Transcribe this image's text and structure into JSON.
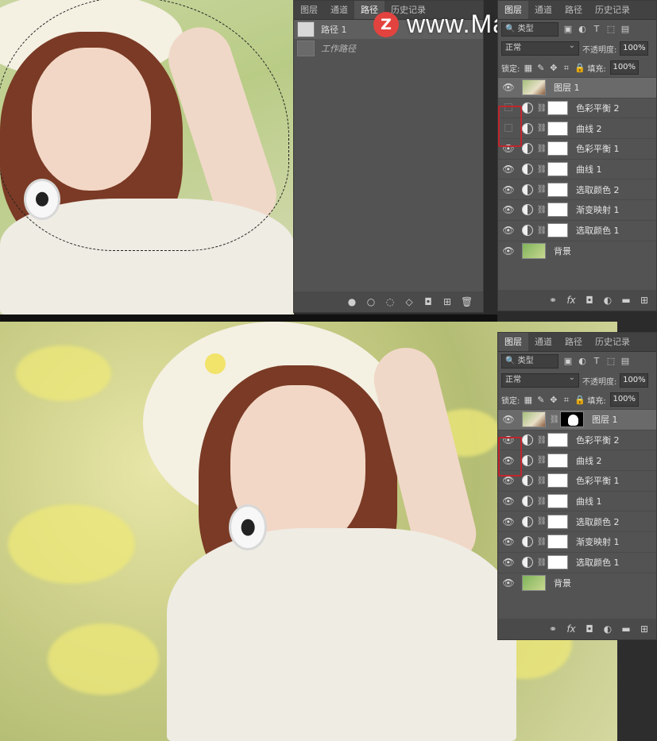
{
  "watermark": {
    "logo_letter": "Z",
    "text": "www.MacZ.com"
  },
  "paths_panel": {
    "tabs": [
      "图层",
      "通道",
      "路径",
      "历史记录"
    ],
    "active_tab": "路径",
    "rows": [
      {
        "name": "路径 1",
        "selected": true
      },
      {
        "name": "工作路径",
        "italic": true
      }
    ],
    "footer_icons": [
      "fill-path-icon",
      "stroke-path-icon",
      "selection-icon",
      "make-path-icon",
      "mask-icon",
      "new-path-icon",
      "trash-icon"
    ]
  },
  "layers_top": {
    "tabs": [
      "图层",
      "通道",
      "路径",
      "历史记录"
    ],
    "active_tab": "图层",
    "search_kind": "类型",
    "blend_mode": "正常",
    "opacity_label": "不透明度:",
    "opacity": "100%",
    "lock_label": "锁定:",
    "fill_label": "填充:",
    "fill": "100%",
    "layers": [
      {
        "name": "图层 1",
        "kind": "pixel",
        "visible": true,
        "selected": true
      },
      {
        "name": "色彩平衡 2",
        "kind": "adj",
        "visible": false
      },
      {
        "name": "曲线 2",
        "kind": "adj",
        "visible": false
      },
      {
        "name": "色彩平衡 1",
        "kind": "adj",
        "visible": true
      },
      {
        "name": "曲线 1",
        "kind": "adj",
        "visible": true
      },
      {
        "name": "选取颜色 2",
        "kind": "adj",
        "visible": true
      },
      {
        "name": "渐变映射 1",
        "kind": "adj",
        "visible": true
      },
      {
        "name": "选取颜色 1",
        "kind": "adj",
        "visible": true
      },
      {
        "name": "背景",
        "kind": "bg",
        "visible": true
      }
    ]
  },
  "layers_bottom": {
    "tabs": [
      "图层",
      "通道",
      "路径",
      "历史记录"
    ],
    "active_tab": "图层",
    "search_kind": "类型",
    "blend_mode": "正常",
    "opacity_label": "不透明度:",
    "opacity": "100%",
    "lock_label": "锁定:",
    "fill_label": "填充:",
    "fill": "100%",
    "layers": [
      {
        "name": "图层 1",
        "kind": "pixel-mask",
        "visible": true,
        "selected": true
      },
      {
        "name": "色彩平衡 2",
        "kind": "adj",
        "visible": true
      },
      {
        "name": "曲线 2",
        "kind": "adj",
        "visible": true
      },
      {
        "name": "色彩平衡 1",
        "kind": "adj",
        "visible": true
      },
      {
        "name": "曲线 1",
        "kind": "adj",
        "visible": true
      },
      {
        "name": "选取颜色 2",
        "kind": "adj",
        "visible": true
      },
      {
        "name": "渐变映射 1",
        "kind": "adj",
        "visible": true
      },
      {
        "name": "选取颜色 1",
        "kind": "adj",
        "visible": true
      },
      {
        "name": "背景",
        "kind": "bg",
        "visible": true
      }
    ]
  },
  "colors": {
    "highlight": "#c0262d",
    "panel": "#535353",
    "accent_logo": "#e2433e"
  }
}
